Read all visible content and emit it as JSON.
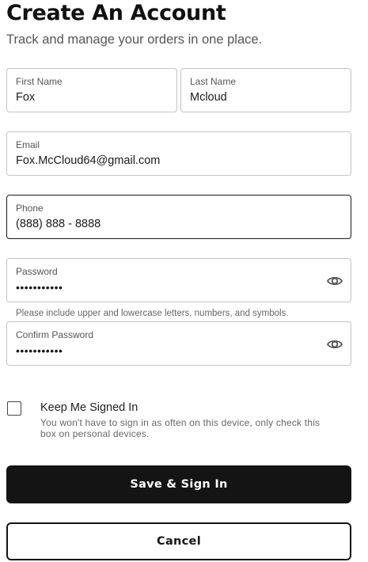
{
  "header": {
    "title": "Create An Account",
    "subtitle": "Track and manage your orders in one place."
  },
  "form": {
    "first_name": {
      "label": "First Name",
      "value": "Fox"
    },
    "last_name": {
      "label": "Last Name",
      "value": "Mcloud"
    },
    "email": {
      "label": "Email",
      "value": "Fox.McCloud64@gmail.com"
    },
    "phone": {
      "label": "Phone",
      "value": "(888) 888 - 8888"
    },
    "password": {
      "label": "Password",
      "value": "•••••••••••"
    },
    "password_hint": "Please include upper and lowercase letters, numbers, and symbols.",
    "confirm_password": {
      "label": "Confirm Password",
      "value": "•••••••••••"
    },
    "keep_signed_in": {
      "label": "Keep Me Signed In",
      "description": "You won't have to sign in as often on this device, only check this box on personal devices.",
      "checked": false
    }
  },
  "actions": {
    "save_label": "Save & Sign In",
    "cancel_label": "Cancel"
  },
  "icons": {
    "password_toggle": "eye-icon",
    "confirm_password_toggle": "eye-icon"
  },
  "colors": {
    "primary_button_bg": "#141414",
    "field_border": "#c4c4c4",
    "focused_border": "#1a1a1a"
  }
}
